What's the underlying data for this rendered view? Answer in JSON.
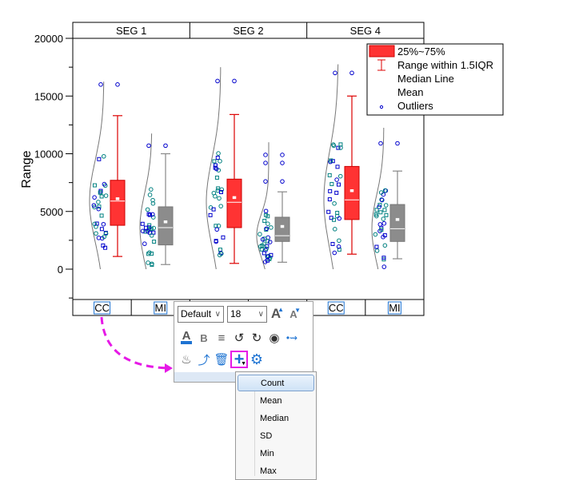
{
  "chart_data": {
    "type": "box",
    "ylabel": "Range",
    "xlabel": "",
    "ylim": [
      -2500,
      21000
    ],
    "yticks": [
      0,
      5000,
      10000,
      15000,
      20000
    ],
    "ytick_labels": [
      "0",
      "5000",
      "10000",
      "15000",
      "20000"
    ],
    "panels": [
      "SEG 1",
      "SEG 2",
      "SEG 4"
    ],
    "categories": [
      "CC",
      "MI"
    ],
    "boxes": [
      {
        "panel": "SEG 1",
        "category": "CC",
        "whisker_low": 1100,
        "q1": 3800,
        "median": 5900,
        "q3": 7700,
        "whisker_high": 13300,
        "mean": 6100,
        "outliers": [
          16000
        ],
        "color": "#ff3333",
        "dist_max": 16300
      },
      {
        "panel": "SEG 1",
        "category": "MI",
        "whisker_low": 400,
        "q1": 2100,
        "median": 3600,
        "q3": 5400,
        "whisker_high": 10000,
        "mean": 4100,
        "outliers": [
          10700
        ],
        "color": "#8c8c8c",
        "dist_max": 11900
      },
      {
        "panel": "SEG 2",
        "category": "CC",
        "whisker_low": 500,
        "q1": 3600,
        "median": 5800,
        "q3": 7800,
        "whisker_high": 13400,
        "mean": 6200,
        "outliers": [
          16300
        ],
        "color": "#ff3333",
        "dist_max": 17500
      },
      {
        "panel": "SEG 2",
        "category": "MI",
        "whisker_low": 600,
        "q1": 2400,
        "median": 2900,
        "q3": 4500,
        "whisker_high": 6700,
        "mean": 3700,
        "outliers": [
          9200,
          9900,
          7600
        ],
        "color": "#8c8c8c",
        "dist_max": 11000
      },
      {
        "panel": "SEG 4",
        "category": "CC",
        "whisker_low": 1300,
        "q1": 4300,
        "median": 6000,
        "q3": 8900,
        "whisker_high": 15000,
        "mean": 6800,
        "outliers": [
          17000
        ],
        "color": "#ff3333",
        "dist_max": 17800
      },
      {
        "panel": "SEG 4",
        "category": "MI",
        "whisker_low": 900,
        "q1": 2400,
        "median": 3500,
        "q3": 5600,
        "whisker_high": 8500,
        "mean": 4300,
        "outliers": [
          10900
        ],
        "color": "#8c8c8c",
        "dist_max": 12400
      }
    ],
    "legend": {
      "position": "top-right",
      "entries": [
        "25%~75%",
        "Range within 1.5IQR",
        "Median Line",
        "Mean",
        "Outliers"
      ]
    },
    "grid": false
  },
  "toolbar": {
    "font_value": "Default",
    "size_value": "18",
    "icons_row1": [
      "increase-font-icon",
      "decrease-font-icon"
    ],
    "icons_row2": [
      "font-color-icon",
      "bold-icon",
      "wrap-text-icon",
      "rotate-left-icon",
      "rotate-right-icon",
      "hide-icon",
      "connect-icon"
    ],
    "icons_row3": [
      "fill-color-icon",
      "swap-axes-icon",
      "delete-icon",
      "add-statistic-icon",
      "settings-icon"
    ]
  },
  "menu": {
    "items": [
      "Count",
      "Mean",
      "Median",
      "SD",
      "Min",
      "Max"
    ],
    "active": "Count"
  },
  "colors": {
    "cc_box": "#ff3333",
    "mi_box": "#8c8c8c",
    "outlier": "#0000cc",
    "point_teal": "#008080",
    "highlight": "#e619e6",
    "accent_blue": "#1e73d2"
  }
}
